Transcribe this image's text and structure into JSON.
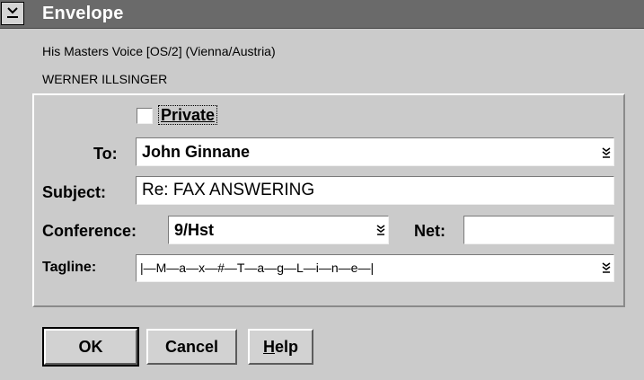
{
  "window": {
    "title": "Envelope",
    "info_line1": "His Masters Voice [OS/2] (Vienna/Austria)",
    "info_line2": "WERNER ILLSINGER"
  },
  "form": {
    "private_label": "Private",
    "private_checked": false,
    "to_label": "To:",
    "to_value": "John Ginnane",
    "subject_label": "Subject:",
    "subject_value": "Re: FAX ANSWERING",
    "conference_label": "Conference:",
    "conference_value": "9/Hst",
    "net_label": "Net:",
    "net_value": "",
    "tagline_label": "Tagline:",
    "tagline_value": "|—M—a—x—#—T—a—g—L—i—n—e—|"
  },
  "buttons": {
    "ok": "OK",
    "cancel": "Cancel",
    "help": "Help"
  },
  "icons": {
    "system_menu": "system-menu-icon",
    "dropdown": "dropdown-arrow-icon"
  },
  "colors": {
    "titlebar": "#6a6a6a",
    "dialog_bg": "#cbcbcb",
    "field_bg": "#ffffff"
  }
}
